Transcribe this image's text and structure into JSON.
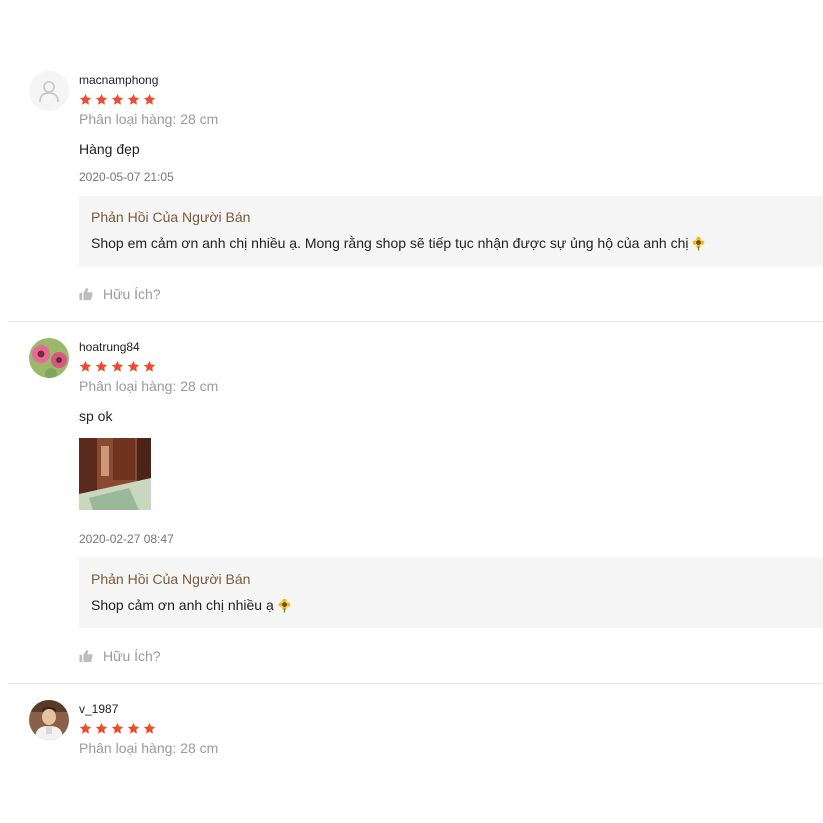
{
  "colors": {
    "star": "#ee4d2d",
    "reply_title": "#7a5a3a",
    "reply_bg": "#f5f5f5",
    "muted": "#9a9a9a"
  },
  "icons": {
    "star": "star-icon",
    "like": "thumbs-up-icon",
    "emoji": "sunflower-emoji-icon",
    "default_avatar": "user-placeholder-icon"
  },
  "reviews": [
    {
      "username": "macnamphong",
      "rating": 5,
      "variation": "Phân loại hàng: 28 cm",
      "comment": "Hàng đẹp",
      "time": "2020-05-07 21:05",
      "reply_title": "Phản Hồi Của Người Bán",
      "reply_text": "Shop em cảm ơn anh chị nhiều ạ. Mong rằng shop sẽ tiếp tục nhận được sự ủng hộ của anh chị",
      "helpful": "Hữu Ích?"
    },
    {
      "username": "hoatrung84",
      "rating": 5,
      "variation": "Phân loại hàng: 28 cm",
      "comment": "sp ok",
      "time": "2020-02-27 08:47",
      "reply_title": "Phản Hồi Của Người Bán",
      "reply_text": "Shop cảm ơn anh chị nhiều ạ",
      "helpful": "Hữu Ích?"
    },
    {
      "username": "v_1987",
      "rating": 5,
      "variation": "Phân loại hàng: 28 cm"
    }
  ]
}
